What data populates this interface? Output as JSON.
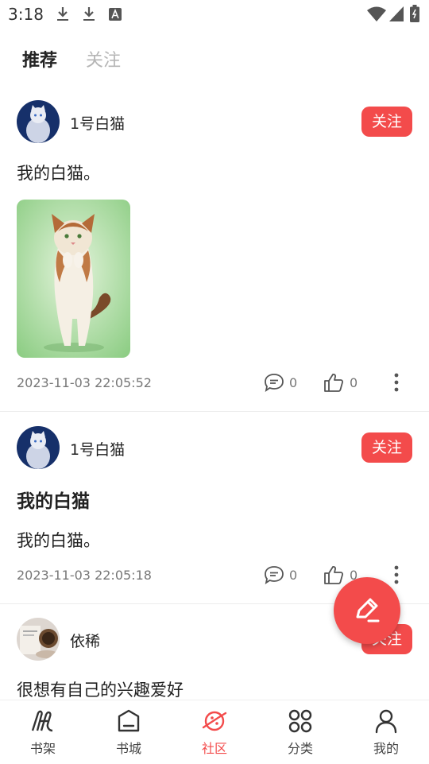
{
  "status_bar": {
    "time": "3:18",
    "left_icons": [
      "download-icon",
      "download-icon",
      "font-icon"
    ],
    "right_icons": [
      "wifi-icon",
      "signal-icon",
      "battery-icon"
    ]
  },
  "tabs": [
    {
      "label": "推荐",
      "active": true
    },
    {
      "label": "关注",
      "active": false
    }
  ],
  "posts": [
    {
      "author": "1号白猫",
      "follow_label": "关注",
      "text": "我的白猫。",
      "date": "2023-11-03 22:05:52",
      "comments": "0",
      "likes": "0"
    },
    {
      "author": "1号白猫",
      "follow_label": "关注",
      "title": "我的白猫",
      "text": "我的白猫。",
      "date": "2023-11-03 22:05:18",
      "comments": "0",
      "likes": "0"
    },
    {
      "author": "依稀",
      "follow_label": "关注",
      "text": "很想有自己的兴趣爱好"
    }
  ],
  "fab": {
    "icon": "edit-icon"
  },
  "bottom_nav": [
    {
      "label": "书架",
      "icon": "bookshelf-icon",
      "active": false
    },
    {
      "label": "书城",
      "icon": "bookstore-icon",
      "active": false
    },
    {
      "label": "社区",
      "icon": "planet-icon",
      "active": true
    },
    {
      "label": "分类",
      "icon": "category-icon",
      "active": false
    },
    {
      "label": "我的",
      "icon": "profile-icon",
      "active": false
    }
  ],
  "colors": {
    "accent": "#f34b4b",
    "muted": "#b5b5b5",
    "meta": "#777777"
  }
}
